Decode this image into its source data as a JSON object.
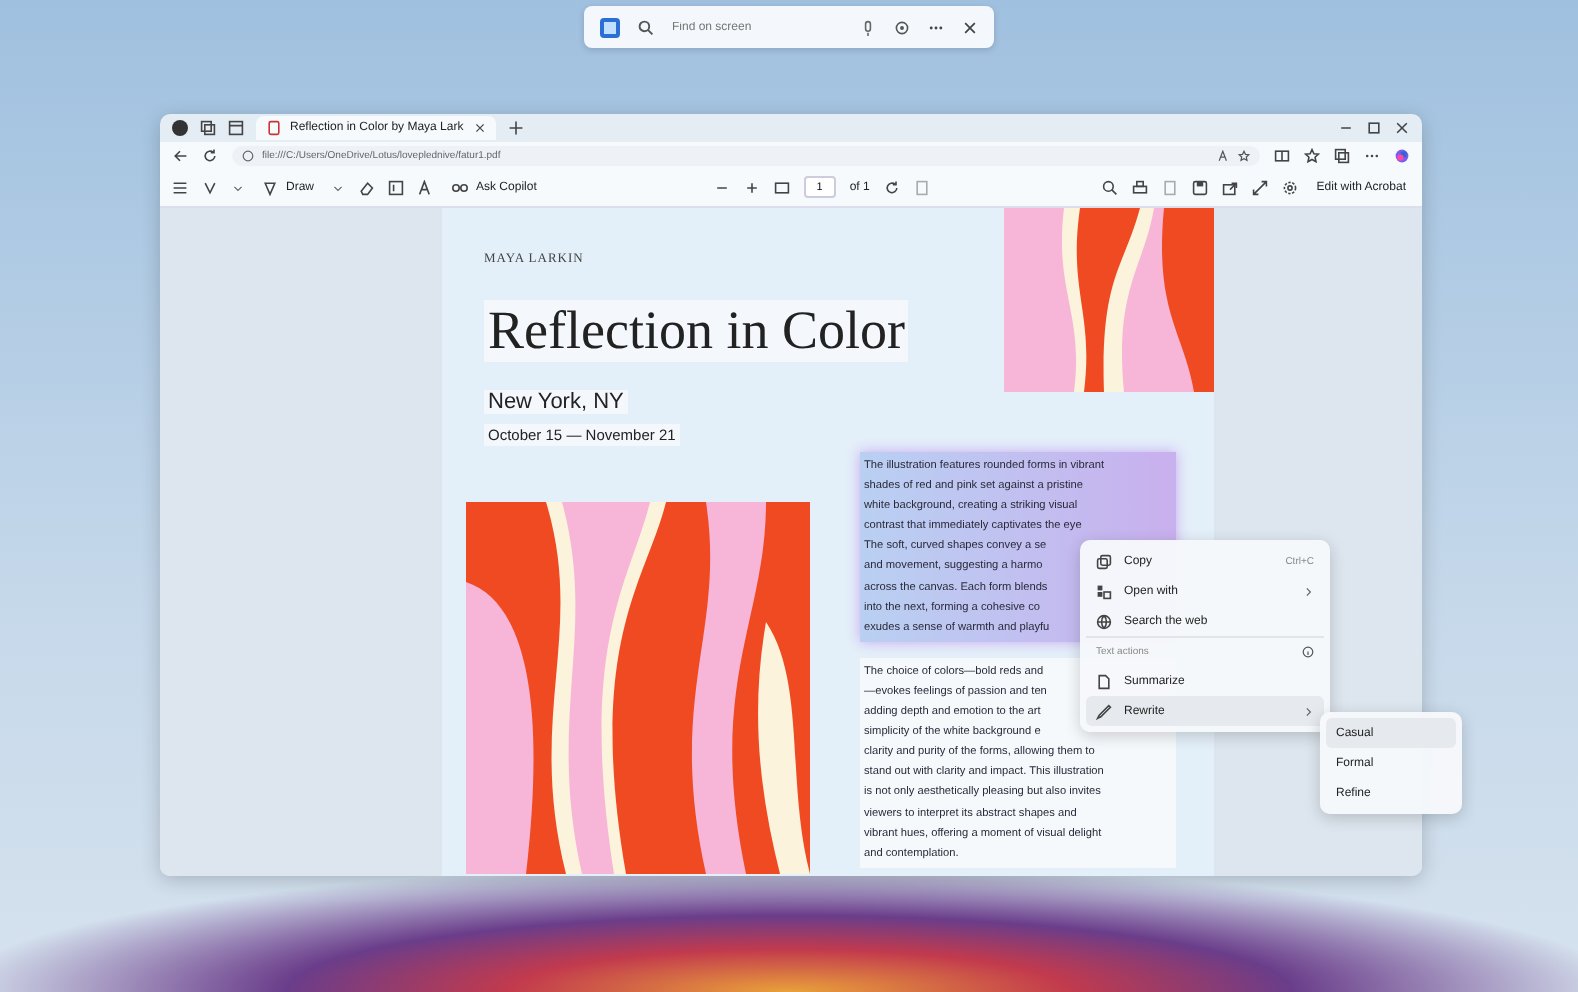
{
  "search_bar": {
    "placeholder": "Find on screen"
  },
  "browser": {
    "tab": {
      "title": "Reflection in Color by Maya Lark",
      "selected": true
    },
    "address": "file:///C:/Users/OneDrive/Lotus/loveplednive/fatur1.pdf"
  },
  "pdf_toolbar": {
    "draw": "Draw",
    "ask_copilot": "Ask Copilot",
    "page": "1",
    "page_count": "of 1",
    "edit": "Edit with Acrobat"
  },
  "document": {
    "author": "MAYA LARKIN",
    "title": "Reflection in Color",
    "location": "New York, NY",
    "dates": "October 15 — November 21",
    "paragraphs": [
      {
        "highlighted": true,
        "lines": [
          "The illustration features rounded forms in vibrant",
          "shades of red and pink set against a pristine",
          "white background, creating a striking visual",
          "contrast that immediately captivates the eye",
          "The soft, curved shapes convey a se",
          "and movement, suggesting a harmo",
          "across the canvas. Each form blends",
          "into the next, forming a cohesive co",
          "exudes a sense of warmth and playfu"
        ]
      },
      {
        "highlighted": false,
        "lines": [
          "The choice of colors—bold reds and",
          "—evokes feelings of passion and ten",
          "adding depth and emotion to the art",
          "simplicity of the white background e",
          "clarity and purity of the forms, allowing them to",
          "stand out with clarity and impact. This illustration",
          "is not only aesthetically pleasing but also invites",
          "viewers to interpret its abstract shapes and",
          "vibrant hues, offering a moment of visual delight",
          "and contemplation."
        ]
      }
    ]
  },
  "context_menu": {
    "items": [
      {
        "kind": "item",
        "label": "Copy",
        "shortcut": "Ctrl+C",
        "selected": false
      },
      {
        "kind": "item",
        "label": "Open with",
        "submenu": true,
        "selected": false
      },
      {
        "kind": "item",
        "label": "Search the web",
        "selected": false
      },
      {
        "kind": "heading",
        "label": "Text actions"
      },
      {
        "kind": "item",
        "label": "Summarize",
        "selected": false
      },
      {
        "kind": "item",
        "label": "Rewrite",
        "submenu": true,
        "selected": true
      }
    ]
  },
  "submenu": {
    "items": [
      {
        "label": "Casual",
        "selected": true
      },
      {
        "label": "Formal",
        "selected": false
      },
      {
        "label": "Refine",
        "selected": false
      }
    ]
  }
}
